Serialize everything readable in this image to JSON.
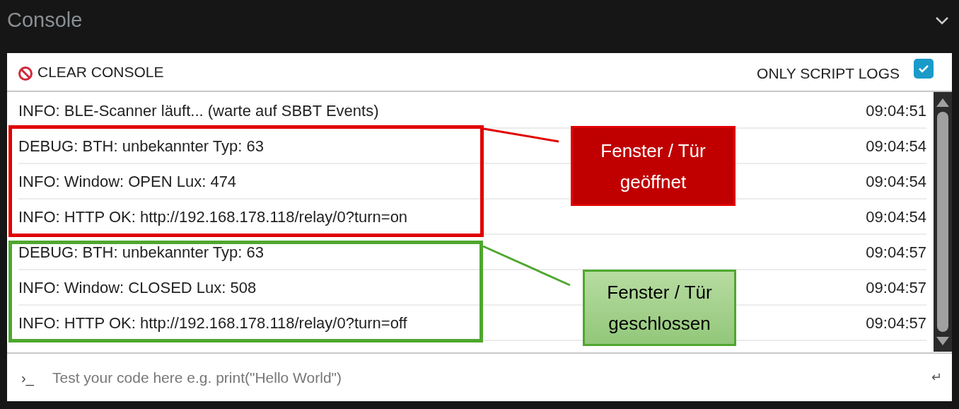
{
  "title": "Console",
  "toolbar": {
    "clear_button": "CLEAR CONSOLE",
    "filter_label": "ONLY SCRIPT LOGS",
    "filter_checked": true
  },
  "logs": [
    {
      "message": "INFO: BLE-Scanner läuft... (warte auf SBBT Events)",
      "time": "09:04:51"
    },
    {
      "message": "DEBUG: BTH: unbekannter Typ: 63",
      "time": "09:04:54"
    },
    {
      "message": "INFO: Window: OPEN Lux: 474",
      "time": "09:04:54"
    },
    {
      "message": "INFO: HTTP OK: http://192.168.178.118/relay/0?turn=on",
      "time": "09:04:54"
    },
    {
      "message": "DEBUG: BTH: unbekannter Typ: 63",
      "time": "09:04:57"
    },
    {
      "message": "INFO: Window: CLOSED Lux: 508",
      "time": "09:04:57"
    },
    {
      "message": "INFO: HTTP OK: http://192.168.178.118/relay/0?turn=off",
      "time": "09:04:57"
    }
  ],
  "annotations": [
    {
      "kind": "open",
      "color": "#e00000",
      "label": "Fenster / Tür geöffnet"
    },
    {
      "kind": "closed",
      "color": "#4ea72e",
      "label": "Fenster / Tür geschlossen"
    }
  ],
  "input": {
    "prompt": "›_",
    "placeholder": "Test your code here e.g. print(\"Hello World\")",
    "enter": "↵"
  }
}
